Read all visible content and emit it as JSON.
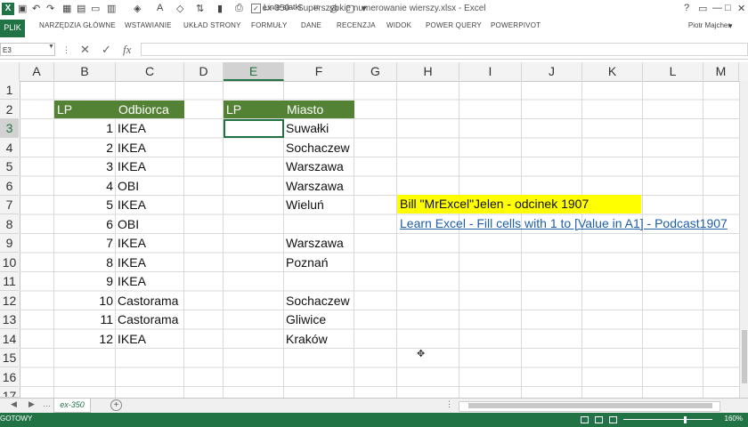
{
  "app": {
    "title": "ex-350 - Superszybkie numerowanie wierszy.xlsx - Excel",
    "logo_text": "X",
    "user": "Piotr Majcher",
    "gridlines_label": "Linie siatki"
  },
  "ribbon": {
    "file": "PLIK",
    "tabs": [
      "NARZĘDZIA GŁÓWNE",
      "WSTAWIANIE",
      "UKŁAD STRONY",
      "FORMUŁY",
      "DANE",
      "RECENZJA",
      "WIDOK",
      "POWER QUERY",
      "POWERPIVOT"
    ]
  },
  "formula_bar": {
    "name_box": "E3",
    "cancel": "✕",
    "confirm": "✓",
    "fx": "fx",
    "value": ""
  },
  "columns": [
    "A",
    "B",
    "C",
    "D",
    "E",
    "F",
    "G",
    "H",
    "I",
    "J",
    "K",
    "L",
    "M"
  ],
  "rows": [
    "1",
    "2",
    "3",
    "4",
    "5",
    "6",
    "7",
    "8",
    "9",
    "10",
    "11",
    "12",
    "13",
    "14",
    "15",
    "16",
    "17"
  ],
  "selected": {
    "column": "E",
    "row": "3"
  },
  "table1": {
    "header_lp": "LP",
    "header_odbiorca": "Odbiorca",
    "rows": [
      {
        "lp": "1",
        "name": "IKEA"
      },
      {
        "lp": "2",
        "name": "IKEA"
      },
      {
        "lp": "3",
        "name": "IKEA"
      },
      {
        "lp": "4",
        "name": "OBI"
      },
      {
        "lp": "5",
        "name": "IKEA"
      },
      {
        "lp": "6",
        "name": "OBI"
      },
      {
        "lp": "7",
        "name": "IKEA"
      },
      {
        "lp": "8",
        "name": "IKEA"
      },
      {
        "lp": "9",
        "name": "IKEA"
      },
      {
        "lp": "10",
        "name": "Castorama"
      },
      {
        "lp": "11",
        "name": "Castorama"
      },
      {
        "lp": "12",
        "name": "IKEA"
      }
    ]
  },
  "table2": {
    "header_lp": "LP",
    "header_miasto": "Miasto",
    "cities": [
      "Suwałki",
      "Sochaczew",
      "Warszawa",
      "Warszawa",
      "Wieluń",
      "",
      "Warszawa",
      "Poznań",
      "",
      "Sochaczew",
      "Gliwice",
      "Kraków"
    ]
  },
  "notes": {
    "bill": "Bill \"MrExcel\"Jelen - odcinek 1907",
    "podcast": "Learn Excel - Fill cells with 1 to [Value in A1] - Podcast1907"
  },
  "sheets": {
    "active": "ex-350",
    "add": "+"
  },
  "status": {
    "text": "GOTOWY",
    "zoom": "160%"
  },
  "colors": {
    "excel_green": "#217346",
    "header_fill": "#548235",
    "highlight": "#ffff00",
    "link": "#1f5ea8"
  }
}
